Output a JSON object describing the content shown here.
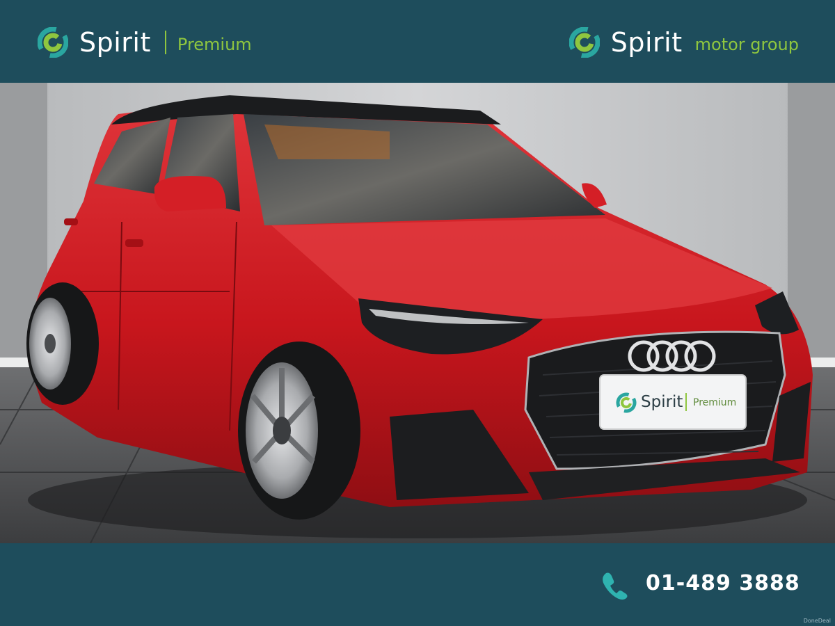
{
  "header": {
    "left_brand": {
      "logo_icon": "spirit-swirl-icon",
      "name": "Spirit",
      "sub": "Premium"
    },
    "right_brand": {
      "logo_icon": "spirit-swirl-icon",
      "name": "Spirit",
      "sub": "motor group"
    }
  },
  "photo": {
    "number_plate": {
      "name": "Spirit",
      "sub": "Premium"
    }
  },
  "footer": {
    "phone_icon": "phone-icon",
    "phone_number": "01-489 3888",
    "watermark": "DoneDeal"
  },
  "colors": {
    "bar": "#1e4d5c",
    "brand_green": "#8fc63f",
    "car_red": "#c8161d"
  }
}
